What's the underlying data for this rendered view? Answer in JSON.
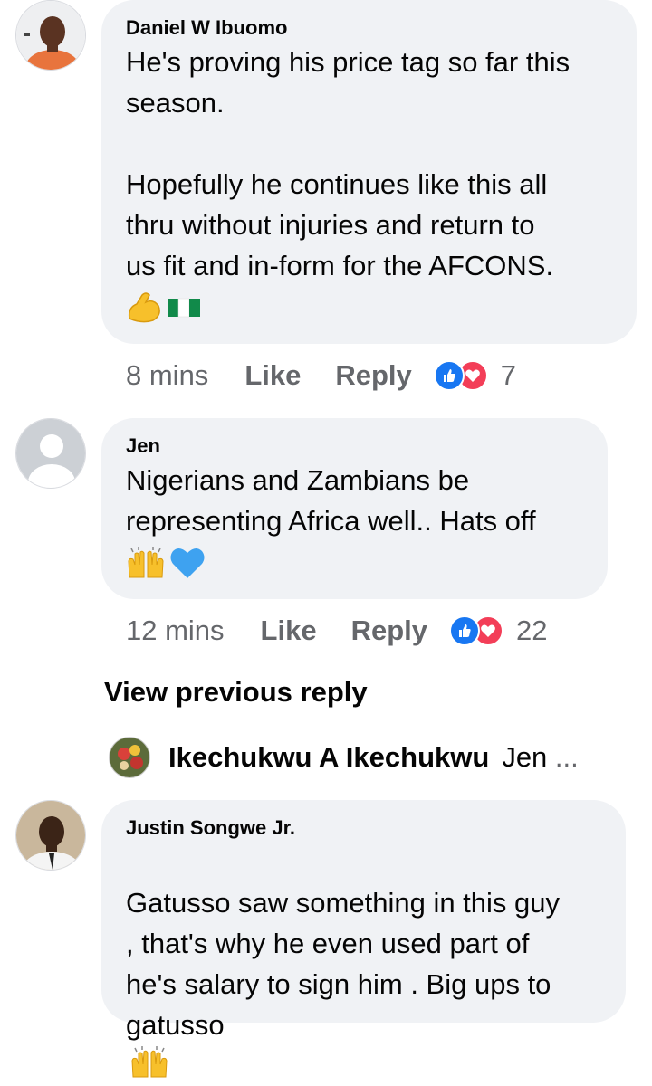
{
  "comments": [
    {
      "author": "Daniel W Ibuomo",
      "text": "He's proving his price tag so far this\nseason.\n\nHopefully he continues like this all\nthru without injuries and return to\nus fit and in-form for the AFCONS.",
      "emojis": [
        "flexed-biceps",
        "nigeria-flag"
      ],
      "time": "8 mins",
      "like_label": "Like",
      "reply_label": "Reply",
      "reaction_count": "7"
    },
    {
      "author": "Jen",
      "text": "Nigerians and Zambians be\nrepresenting Africa well.. Hats off",
      "emojis": [
        "raising-hands",
        "blue-heart"
      ],
      "time": "12 mins",
      "like_label": "Like",
      "reply_label": "Reply",
      "reaction_count": "22"
    },
    {
      "author": "Justin Songwe Jr.",
      "text": "Gatusso saw something in this guy\n, that's why he even used part of\nhe's salary to sign him . Big ups to\ngatusso",
      "emojis": [
        "raising-hands"
      ]
    }
  ],
  "view_previous_label": "View previous reply",
  "reply_preview": {
    "name": "Ikechukwu A Ikechukwu",
    "snippet": "Jen",
    "ellipsis": "..."
  },
  "colors": {
    "bubble": "#f0f2f5",
    "meta_text": "#65676b",
    "like_blue": "#1877f2",
    "love_red": "#f33e58"
  }
}
